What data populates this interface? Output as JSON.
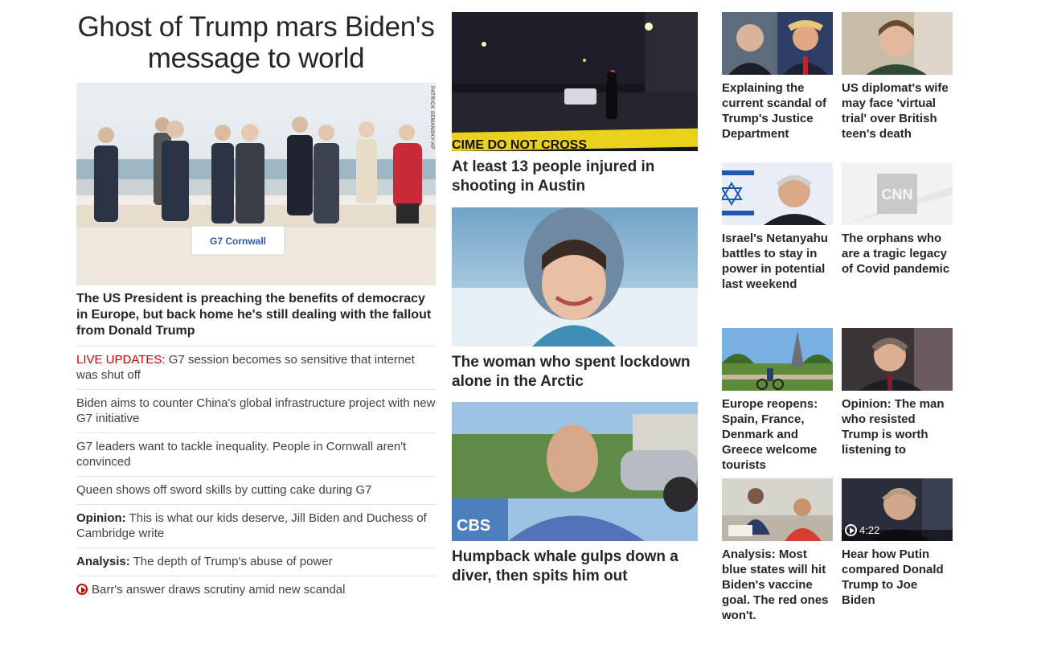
{
  "lead": {
    "title": "Ghost of Trump mars Biden's message to world",
    "photo_credit": "PATRICK SEMANSKY/AP",
    "g7_sign": "G7 Cornwall",
    "summary": "The US President is preaching the benefits of democracy in Europe, but back home he's still dealing with the fallout from Donald Trump",
    "bullets": [
      {
        "prefix": "LIVE UPDATES:",
        "text": " G7 session becomes so sensitive that internet was shut off"
      },
      {
        "prefix": "",
        "text": "Biden aims to counter China's global infrastructure project with new G7 initiative"
      },
      {
        "prefix": "",
        "text": "G7 leaders want to tackle inequality. People in Cornwall aren't convinced"
      },
      {
        "prefix": "",
        "text": "Queen shows off sword skills by cutting cake during G7"
      },
      {
        "prefix": "Opinion:",
        "text": " This is what our kids deserve, Jill Biden and Duchess of Cambridge write"
      },
      {
        "prefix": "Analysis:",
        "text": " The depth of Trump's abuse of power"
      },
      {
        "prefix": "",
        "text": "Barr's answer draws scrutiny amid new scandal"
      }
    ]
  },
  "middle": [
    {
      "title": "At least 13 people injured in shooting in Austin",
      "tape": "CIME DO NOT CROSS"
    },
    {
      "title": "The woman who spent lockdown alone in the Arctic"
    },
    {
      "title": "Humpback whale gulps down a diver, then spits him out",
      "mic": "CBS"
    }
  ],
  "grid": [
    {
      "title": "Explaining the current scandal of Trump's Justice Department"
    },
    {
      "title": "US diplomat's wife may face 'virtual trial' over British teen's death"
    },
    {
      "title": "Israel's Netanyahu battles to stay in power in potential last weekend"
    },
    {
      "title": "The orphans who are a tragic legacy of Covid pandemic",
      "logo": "CNN"
    },
    {
      "title": "Europe reopens: Spain, France, Denmark and Greece welcome tourists"
    },
    {
      "title": "Opinion: The man who resisted Trump is worth listening to"
    },
    {
      "title": "Analysis: Most blue states will hit Biden's vaccine goal. The red ones won't."
    },
    {
      "title": "Hear how Putin compared Donald Trump to Joe Biden",
      "duration": "4:22"
    }
  ],
  "colors": {
    "text": "#262626",
    "live": "#cc0000",
    "divider": "#e3e3e3"
  }
}
